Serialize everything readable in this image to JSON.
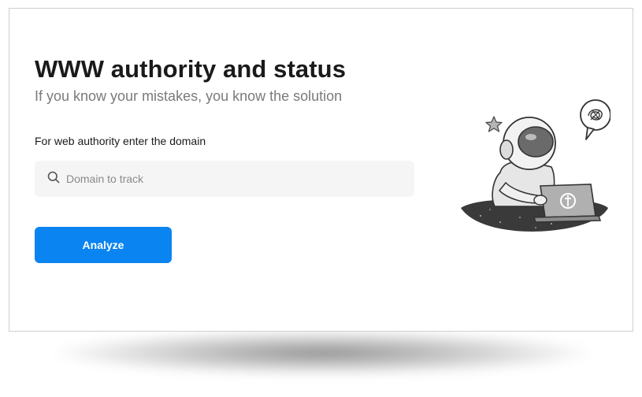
{
  "page": {
    "title": "WWW authority and status",
    "subtitle": "If you know your mistakes, you know the solution"
  },
  "form": {
    "label": "For web authority enter the domain",
    "search_placeholder": "Domain to track",
    "search_value": "",
    "search_icon": "search-icon",
    "submit_label": "Analyze"
  },
  "illustration": {
    "subject": "astronaut-with-laptop",
    "elements": [
      "star-icon",
      "speech-bubble-icon",
      "laptop-icon"
    ]
  },
  "colors": {
    "accent": "#0a84f0",
    "title": "#1a1a1a",
    "subtitle": "#7a7a7a",
    "input_background": "#f5f5f5"
  }
}
